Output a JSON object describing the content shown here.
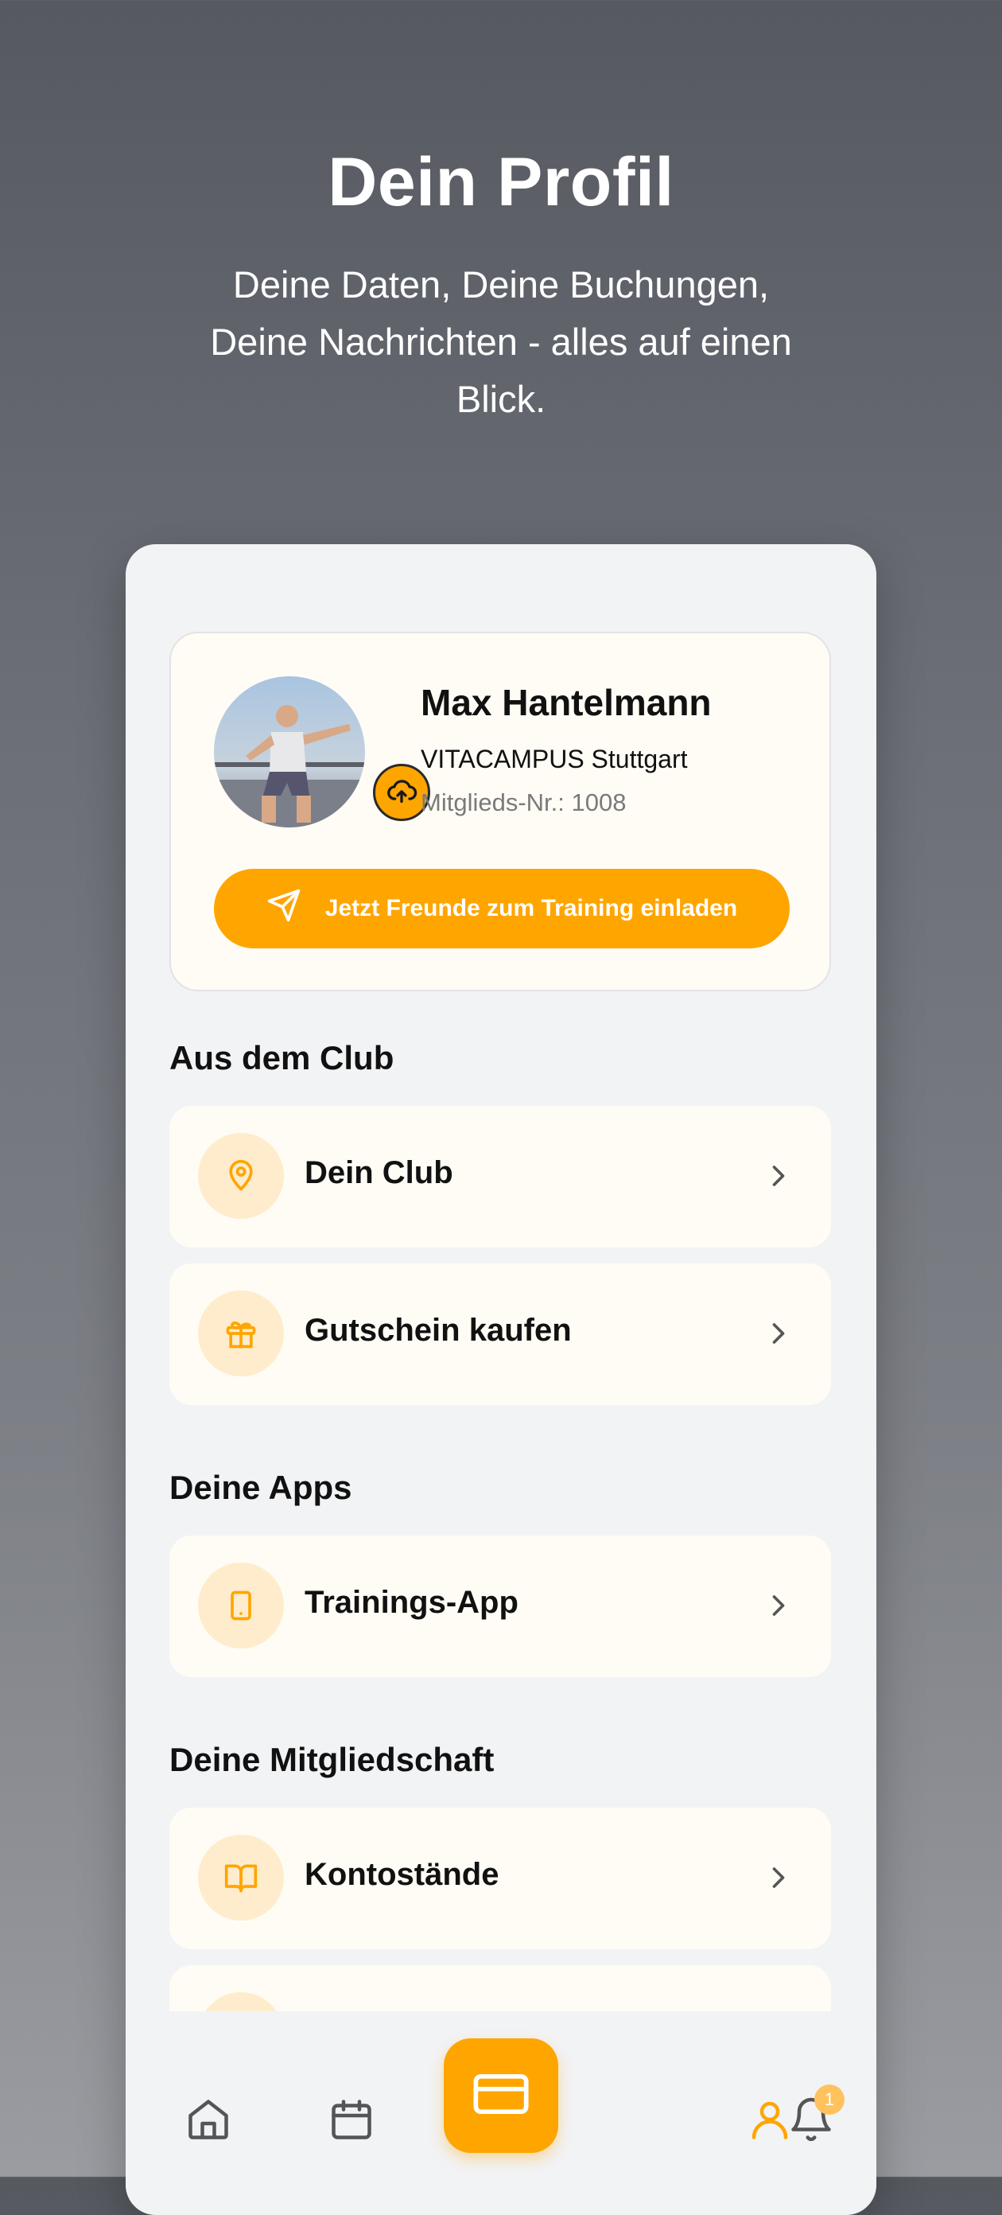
{
  "hero": {
    "title": "Dein Profil",
    "subtitle": "Deine Daten, Deine Buchungen, Deine Nachrichten - alles auf einen Blick."
  },
  "profile": {
    "name": "Max Hantelmann",
    "club": "VITACAMPUS Stuttgart",
    "member_no": "Mitglieds-Nr.: 1008",
    "invite_label": "Jetzt Freunde zum Training einladen"
  },
  "sections": {
    "club": {
      "title": "Aus dem Club",
      "items": [
        {
          "label": "Dein Club",
          "icon": "location-pin-icon"
        },
        {
          "label": "Gutschein kaufen",
          "icon": "gift-icon"
        }
      ]
    },
    "apps": {
      "title": "Deine Apps",
      "items": [
        {
          "label": "Trainings-App",
          "icon": "tablet-icon"
        }
      ]
    },
    "membership": {
      "title": "Deine Mitgliedschaft",
      "items": [
        {
          "label": "Kontostände",
          "icon": "book-icon"
        }
      ]
    }
  },
  "tabbar": {
    "tabs": [
      "home-icon",
      "calendar-icon",
      "card-icon",
      "user-icon",
      "bell-icon"
    ],
    "active": "user-icon",
    "notification_count": "1"
  },
  "colors": {
    "accent": "#ffa500",
    "card_bg": "#fffcf5",
    "icon_bg": "#ffeccc"
  }
}
